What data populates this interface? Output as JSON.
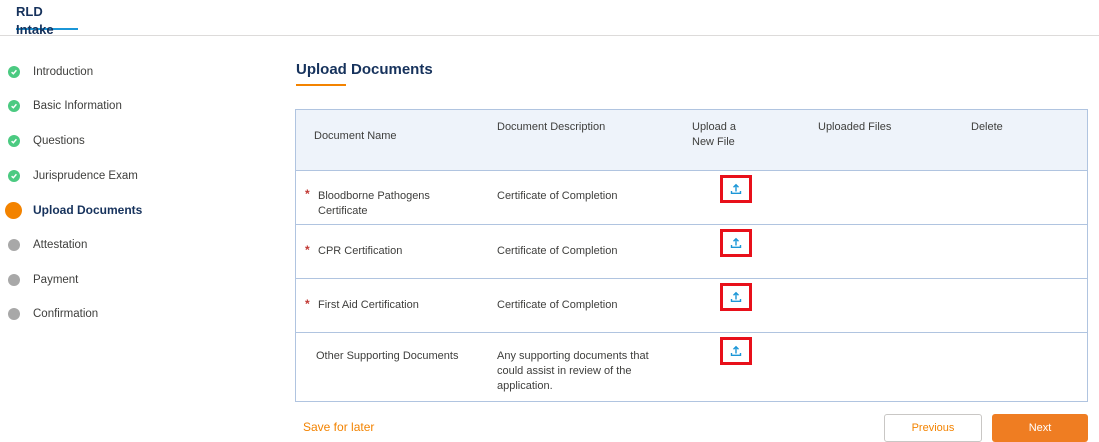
{
  "header": {
    "tab_label": "RLD Intake"
  },
  "steps": [
    {
      "label": "Introduction",
      "status": "done"
    },
    {
      "label": "Basic Information",
      "status": "done"
    },
    {
      "label": "Questions",
      "status": "done"
    },
    {
      "label": "Jurisprudence Exam",
      "status": "done"
    },
    {
      "label": "Upload Documents",
      "status": "current"
    },
    {
      "label": "Attestation",
      "status": "todo"
    },
    {
      "label": "Payment",
      "status": "todo"
    },
    {
      "label": "Confirmation",
      "status": "todo"
    }
  ],
  "main": {
    "title": "Upload Documents",
    "columns": {
      "name": "Document Name",
      "description": "Document Description",
      "upload_line1": "Upload a",
      "upload_line2": "New File",
      "uploaded": "Uploaded Files",
      "delete": "Delete"
    },
    "rows": [
      {
        "required_mark": "*",
        "name_line1": "Bloodborne Pathogens",
        "name_line2": "Certificate",
        "description": "Certificate of Completion",
        "upload_icon": "upload-icon"
      },
      {
        "required_mark": "*",
        "name_line1": "CPR Certification",
        "description": "Certificate of Completion",
        "upload_icon": "upload-icon"
      },
      {
        "required_mark": "*",
        "name_line1": "First Aid Certification",
        "description": "Certificate of Completion",
        "upload_icon": "upload-icon"
      },
      {
        "name_line1": "Other Supporting Documents",
        "desc_line1": "Any supporting documents that",
        "desc_line2": "could assist in review of the",
        "desc_line3": "application.",
        "upload_icon": "upload-icon"
      }
    ]
  },
  "footer": {
    "save_label": "Save for later",
    "previous_label": "Previous",
    "next_label": "Next"
  },
  "colors": {
    "accent_orange": "#f38300",
    "done_green": "#4bca81",
    "todo_gray": "#a8a8a8",
    "highlight_red": "#e8101a",
    "required_red": "#c23934"
  }
}
